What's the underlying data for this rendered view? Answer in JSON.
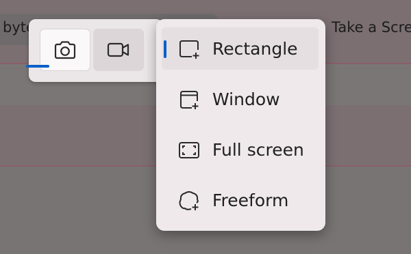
{
  "background": {
    "search_text": "byte",
    "right_text": "Take a Scre"
  },
  "mode_toolbar": {
    "buttons": [
      {
        "icon": "camera-icon",
        "selected": true
      },
      {
        "icon": "video-camera-icon",
        "selected": false
      }
    ]
  },
  "snip_menu": {
    "items": [
      {
        "label": "Rectangle",
        "icon": "rectangle-snip-icon",
        "selected": true
      },
      {
        "label": "Window",
        "icon": "window-snip-icon",
        "selected": false
      },
      {
        "label": "Full screen",
        "icon": "fullscreen-snip-icon",
        "selected": false
      },
      {
        "label": "Freeform",
        "icon": "freeform-snip-icon",
        "selected": false
      }
    ]
  },
  "colors": {
    "accent": "#0a5fc7",
    "menu_bg": "#efe9ec",
    "toolbar_bg": "#ebe6e8"
  }
}
